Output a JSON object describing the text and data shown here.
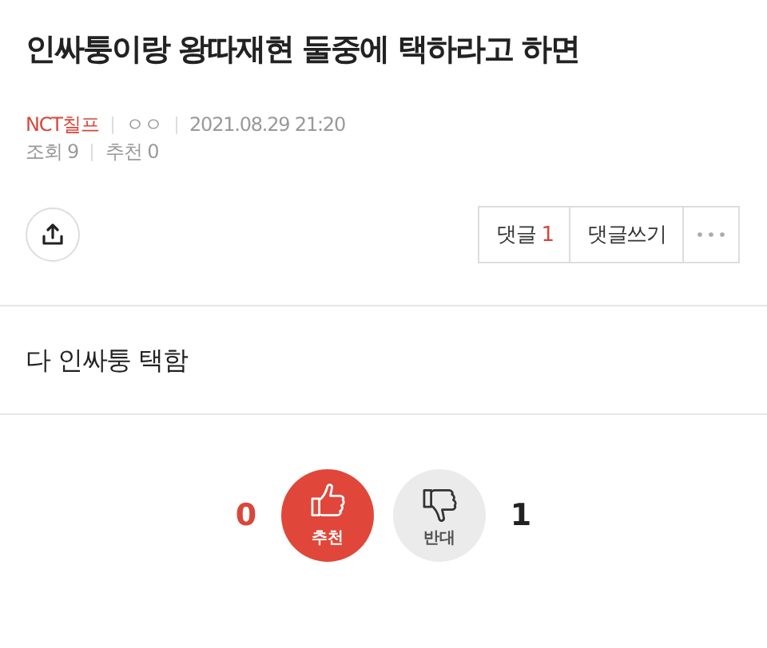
{
  "title": "인싸퉁이랑 왕따재현 둘중에 택하라고 하면",
  "meta": {
    "author": "NCT칠프",
    "nickname": "ㅇㅇ",
    "datetime": "2021.08.29 21:20",
    "views_label": "조회",
    "views": "9",
    "likes_label": "추천",
    "likes": "0"
  },
  "actions": [
    {
      "kind": "comments",
      "label": "댓글",
      "count": "1"
    },
    {
      "kind": "write",
      "label": "댓글쓰기"
    },
    {
      "kind": "more"
    }
  ],
  "body": "다 인싸퉁 택함",
  "votes": [
    {
      "kind": "up",
      "label": "추천",
      "count": "0",
      "selected": true
    },
    {
      "kind": "down",
      "label": "반대",
      "count": "1",
      "selected": false
    }
  ]
}
